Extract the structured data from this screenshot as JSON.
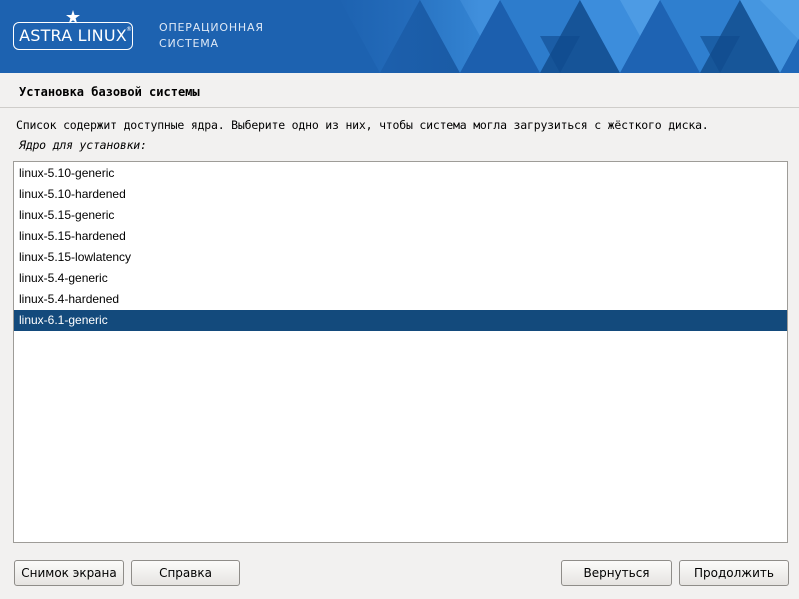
{
  "banner": {
    "logo_text": "ASTRA LINUX",
    "logo_reg": "®",
    "tagline_line1": "ОПЕРАЦИОННАЯ",
    "tagline_line2": "СИСТЕМА",
    "colors": {
      "background": "#1d62b0",
      "text": "#ffffff"
    }
  },
  "step": {
    "title": "Установка базовой системы",
    "description": "Список содержит доступные ядра. Выберите одно из них, чтобы система могла загрузиться с жёсткого диска.",
    "field_label": "Ядро для установки:"
  },
  "kernels": {
    "items": [
      "linux-5.10-generic",
      "linux-5.10-hardened",
      "linux-5.15-generic",
      "linux-5.15-hardened",
      "linux-5.15-lowlatency",
      "linux-5.4-generic",
      "linux-5.4-hardened",
      "linux-6.1-generic"
    ],
    "selected": "linux-6.1-generic",
    "selection_color": "#134a7c"
  },
  "buttons": {
    "screenshot": "Снимок экрана",
    "help": "Справка",
    "back": "Вернуться",
    "continue": "Продолжить"
  }
}
